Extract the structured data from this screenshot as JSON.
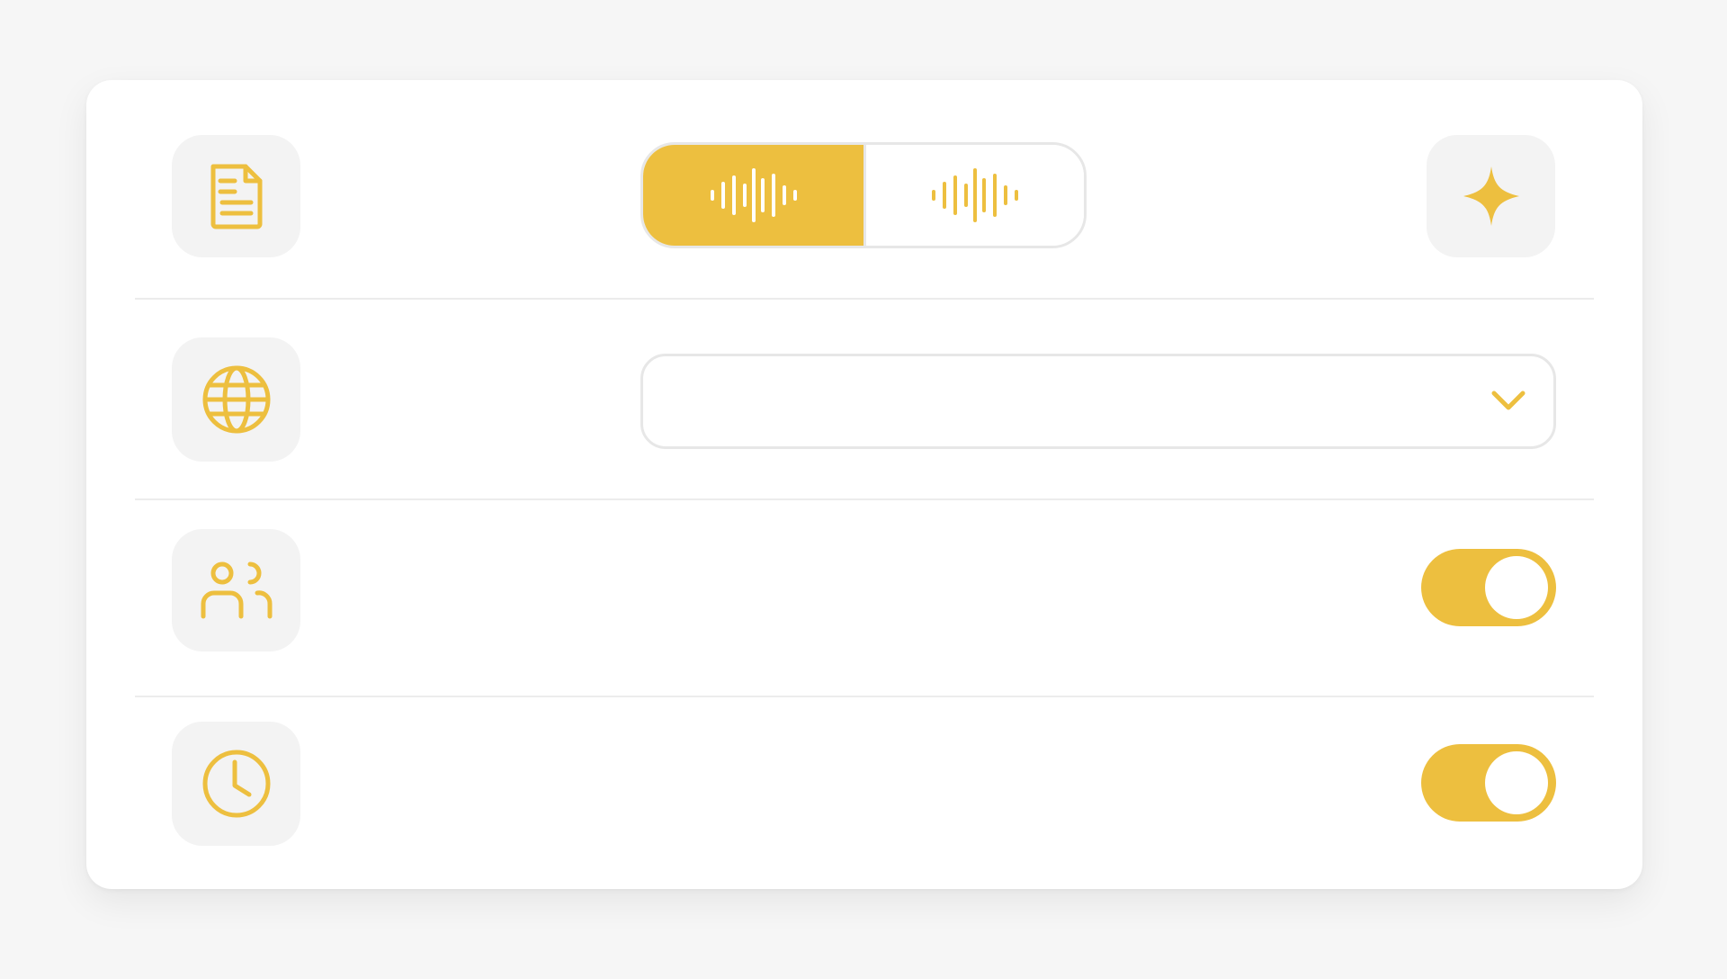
{
  "colors": {
    "accent": "#edbf3f",
    "tile_bg": "#f3f3f3",
    "border": "#e7e7e7",
    "card_bg": "#ffffff",
    "page_bg": "#f6f6f6"
  },
  "rows": [
    {
      "icon": "document-icon",
      "control": "segmented",
      "segments": [
        {
          "icon": "waveform-icon",
          "selected": true
        },
        {
          "icon": "waveform-icon",
          "selected": false
        }
      ],
      "trailing_icon": "sparkle-icon"
    },
    {
      "icon": "globe-icon",
      "control": "select",
      "value": "",
      "trailing_icon": "chevron-down-icon"
    },
    {
      "icon": "users-icon",
      "control": "toggle",
      "on": true
    },
    {
      "icon": "clock-icon",
      "control": "toggle",
      "on": true
    }
  ]
}
